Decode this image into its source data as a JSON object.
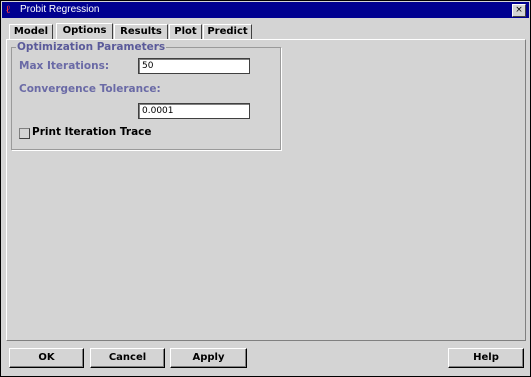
{
  "window": {
    "title": "Probit Regression",
    "close_label": "×"
  },
  "tabs": [
    {
      "label": "Model",
      "active": false
    },
    {
      "label": "Options",
      "active": true
    },
    {
      "label": "Results",
      "active": false
    },
    {
      "label": "Plot",
      "active": false
    },
    {
      "label": "Predict",
      "active": false
    }
  ],
  "optimization": {
    "group_title": "Optimization Parameters",
    "max_iterations_label": "Max Iterations:",
    "max_iterations_value": "50",
    "convergence_label": "Convergence Tolerance:",
    "convergence_value": "0.0001",
    "print_trace_label": "Print Iteration Trace",
    "print_trace_checked": false
  },
  "buttons": {
    "ok": "OK",
    "cancel": "Cancel",
    "apply": "Apply",
    "help": "Help"
  }
}
